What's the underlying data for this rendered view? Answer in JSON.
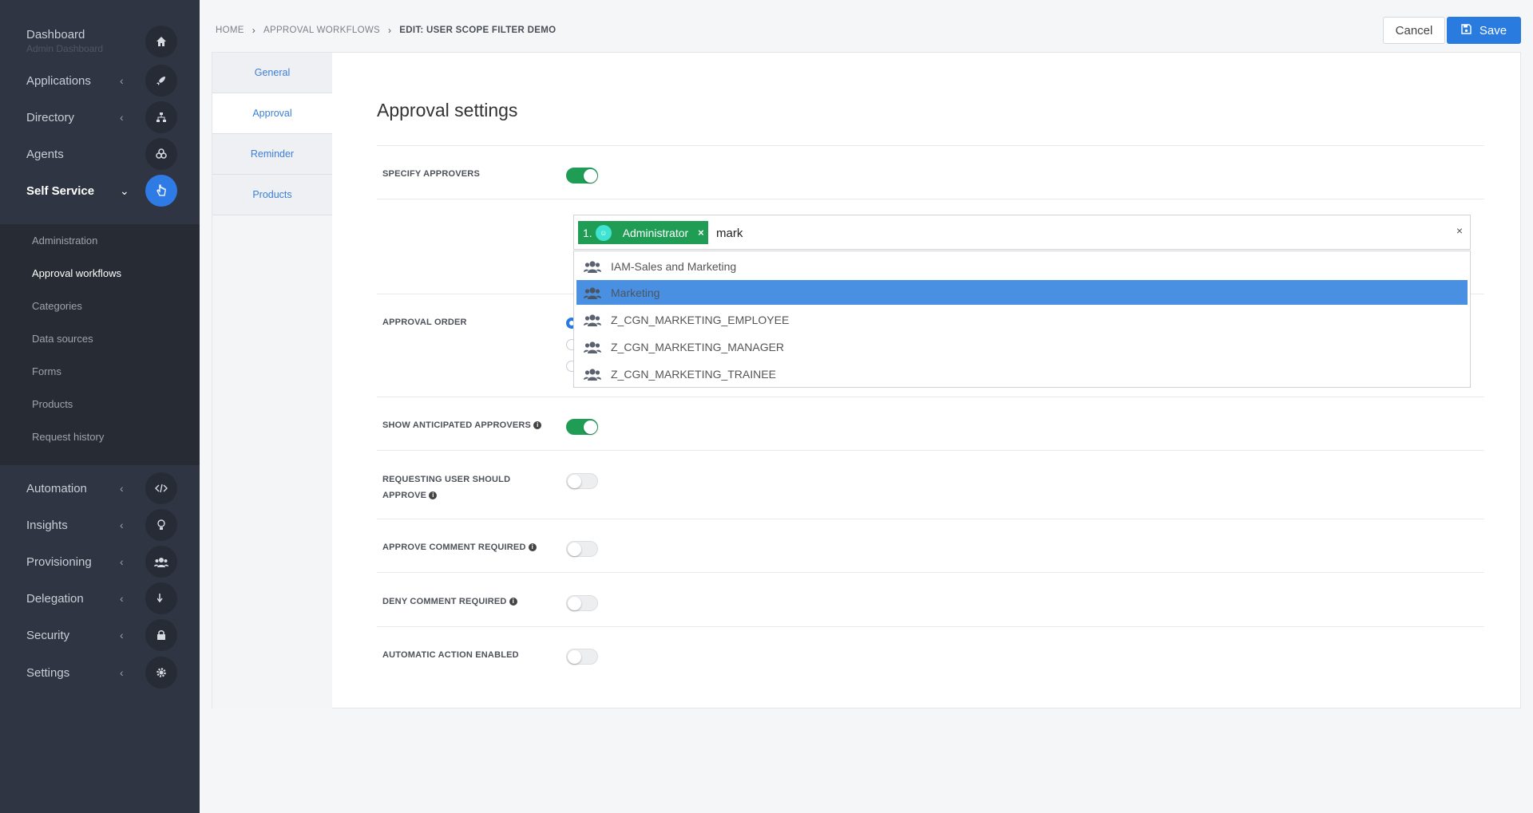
{
  "sidebar": {
    "dashboard": {
      "label": "Dashboard",
      "sub": "Admin Dashboard"
    },
    "items": [
      {
        "label": "Applications",
        "icon": "rocket-icon"
      },
      {
        "label": "Directory",
        "icon": "sitemap-icon"
      },
      {
        "label": "Agents",
        "icon": "agents-icon"
      },
      {
        "label": "Self Service",
        "icon": "hand-pointer-icon"
      }
    ],
    "submenu": [
      "Administration",
      "Approval workflows",
      "Categories",
      "Data sources",
      "Forms",
      "Products",
      "Request history"
    ],
    "lower_items": [
      {
        "label": "Automation",
        "icon": "code-icon"
      },
      {
        "label": "Insights",
        "icon": "lightbulb-icon"
      },
      {
        "label": "Provisioning",
        "icon": "users-icon"
      },
      {
        "label": "Delegation",
        "icon": "arrow-down-icon"
      },
      {
        "label": "Security",
        "icon": "lock-icon"
      },
      {
        "label": "Settings",
        "icon": "gear-icon"
      }
    ]
  },
  "breadcrumb": {
    "home": "HOME",
    "section": "APPROVAL WORKFLOWS",
    "current": "EDIT: USER SCOPE FILTER DEMO"
  },
  "toolbar": {
    "cancel": "Cancel",
    "save": "Save"
  },
  "tabs": [
    "General",
    "Approval",
    "Reminder",
    "Products"
  ],
  "main": {
    "heading": "Approval settings",
    "specify_approvers": "SPECIFY APPROVERS",
    "approval_order": "APPROVAL ORDER",
    "show_anticipated": "SHOW ANTICIPATED APPROVERS",
    "requesting_user_1": "REQUESTING USER SHOULD",
    "requesting_user_2": "APPROVE",
    "approve_comment": "APPROVE COMMENT REQUIRED",
    "deny_comment": "DENY COMMENT REQUIRED",
    "automatic_action": "AUTOMATIC ACTION ENABLED"
  },
  "approver_select": {
    "tag_number": "1.",
    "tag_name": "Administrator",
    "search_value": "mark",
    "options": [
      "IAM-Sales and Marketing",
      "Marketing",
      "Z_CGN_MARKETING_EMPLOYEE",
      "Z_CGN_MARKETING_MANAGER",
      "Z_CGN_MARKETING_TRAINEE"
    ],
    "highlighted": "Marketing"
  }
}
